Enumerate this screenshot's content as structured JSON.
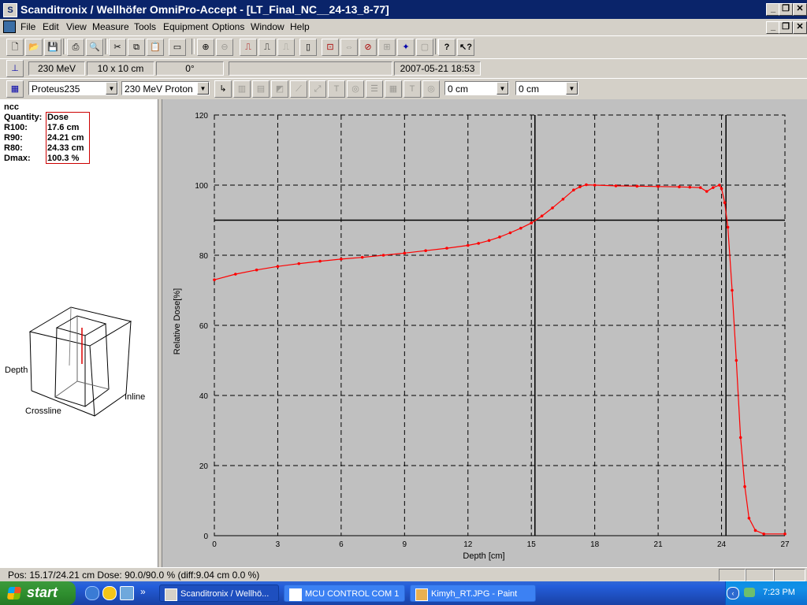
{
  "window": {
    "title": "Scanditronix / Wellhöfer  OmniPro-Accept - [LT_Final_NC__24-13_8-77]",
    "controls": [
      "_",
      "❐",
      "✕"
    ]
  },
  "menu": {
    "items": [
      "File",
      "Edit",
      "View",
      "Measure",
      "Tools",
      "Equipment",
      "Options",
      "Window",
      "Help"
    ]
  },
  "info_bar": {
    "energy": "230 MeV",
    "field_size": "10 x 10 cm",
    "angle": "0°",
    "blank": "",
    "datetime": "2007-05-21 18:53"
  },
  "selector_bar": {
    "machine": "Proteus235",
    "beam": "230 MeV Proton",
    "offset1": "0 cm",
    "offset2": "0 cm"
  },
  "left_panel": {
    "chamber": "ncc",
    "rows": [
      {
        "label": "Quantity:",
        "value": "Dose"
      },
      {
        "label": "R100:",
        "value": "17.6 cm"
      },
      {
        "label": "R90:",
        "value": "24.21 cm"
      },
      {
        "label": "R80:",
        "value": "24.33 cm"
      },
      {
        "label": "Dmax:",
        "value": "100.3 %"
      }
    ],
    "cube_labels": {
      "depth": "Depth",
      "crossline": "Crossline",
      "inline": "Inline"
    }
  },
  "chart_data": {
    "type": "line",
    "xlabel": "Depth [cm]",
    "ylabel": "Relative Dose[%]",
    "xlim": [
      0,
      27
    ],
    "ylim": [
      0,
      120
    ],
    "xticks": [
      0,
      3,
      6,
      9,
      12,
      15,
      18,
      21,
      24,
      27
    ],
    "yticks": [
      0,
      20,
      40,
      60,
      80,
      100,
      120
    ],
    "grid": true,
    "reference_line_y": 90,
    "cursor_x": [
      15.17,
      24.21
    ],
    "series": [
      {
        "color": "#ff0000",
        "x": [
          0,
          1,
          2,
          3,
          4,
          5,
          6,
          7,
          8,
          9,
          10,
          11,
          12,
          12.5,
          13,
          13.5,
          14,
          14.5,
          15,
          15.5,
          16,
          16.5,
          17,
          17.3,
          17.6,
          18,
          19,
          20,
          21,
          22,
          22.5,
          23,
          23.3,
          23.6,
          23.9,
          24.0,
          24.15,
          24.3,
          24.5,
          24.7,
          24.9,
          25.1,
          25.3,
          25.6,
          26,
          27
        ],
        "y": [
          73,
          74.6,
          75.8,
          76.8,
          77.6,
          78.3,
          78.9,
          79.4,
          80.0,
          80.6,
          81.3,
          82.0,
          82.8,
          83.4,
          84.2,
          85.2,
          86.4,
          87.7,
          89.2,
          91.2,
          93.5,
          96.0,
          98.6,
          99.5,
          100.1,
          100.0,
          99.8,
          99.7,
          99.6,
          99.5,
          99.4,
          99.3,
          98.2,
          99.3,
          100.0,
          99.0,
          95.0,
          88.0,
          70.0,
          50.0,
          28.0,
          14.0,
          5.0,
          1.5,
          0.5,
          0.5
        ]
      }
    ]
  },
  "status": {
    "text": "Pos: 15.17/24.21 cm  Dose: 90.0/90.0 % (diff:9.04 cm  0.0 %)"
  },
  "taskbar": {
    "start": "start",
    "tasks": [
      "Scanditronix / Wellhö...",
      "MCU CONTROL  COM 1",
      "Kimyh_RT.JPG - Paint"
    ],
    "clock": "7:23 PM",
    "colors": {
      "start": "#2f8f2f",
      "taskbar": "#245edb"
    }
  }
}
